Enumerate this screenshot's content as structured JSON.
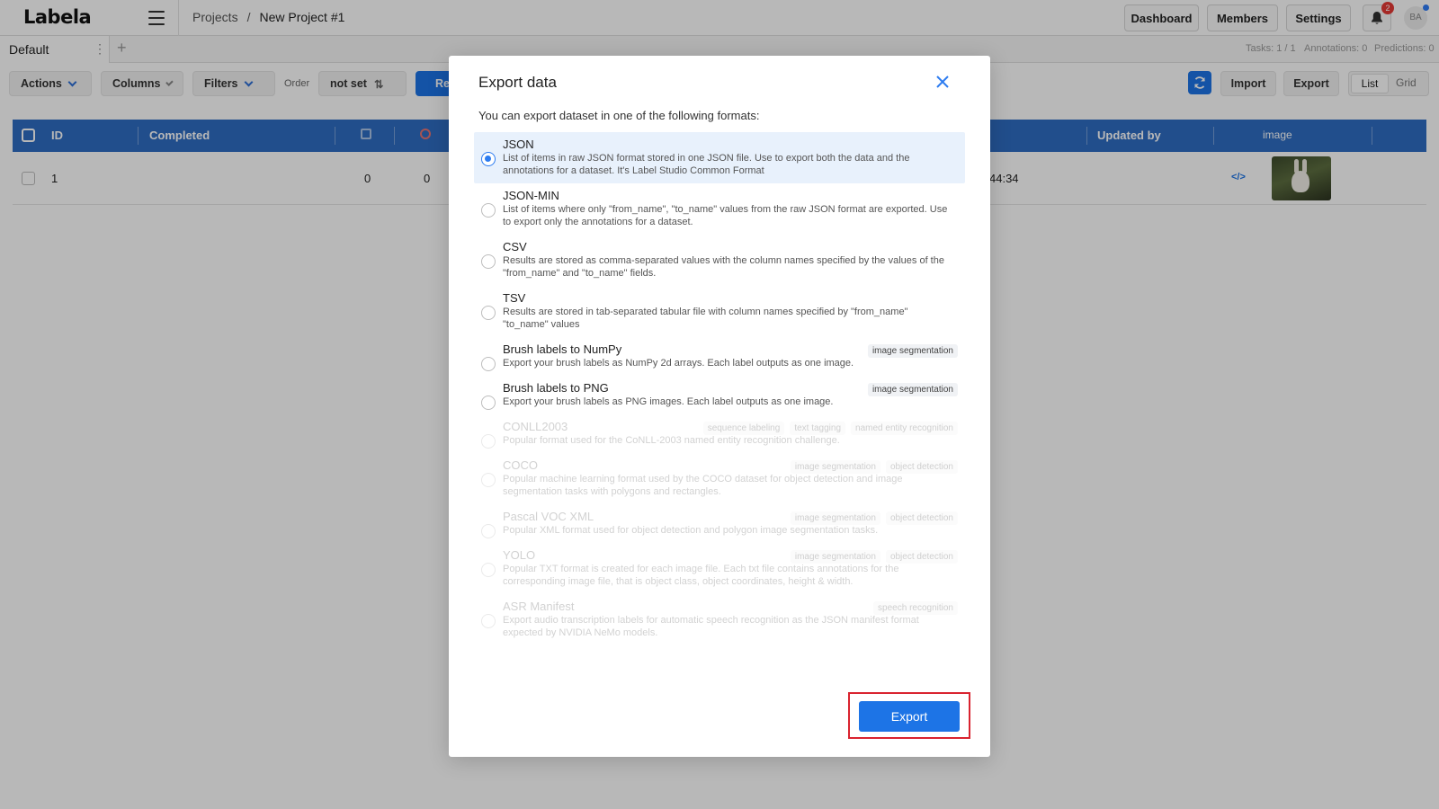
{
  "header": {
    "logo": "Labela",
    "breadcrumbs": [
      "Projects",
      "/",
      "New Project #1"
    ],
    "buttons": {
      "dashboard": "Dashboard",
      "members": "Members",
      "settings": "Settings"
    },
    "notifications_count": "2",
    "avatar_initials": "BA"
  },
  "tabs": {
    "active": "Default",
    "stats": {
      "tasks": "Tasks: 1 / 1",
      "annotations": "Annotations: 0",
      "predictions": "Predictions: 0"
    }
  },
  "toolbar": {
    "actions": "Actions",
    "columns": "Columns",
    "filters": "Filters",
    "order_label": "Order",
    "order_value": "not set",
    "review_partial": "Re",
    "import": "Import",
    "export": "Export",
    "view_list": "List",
    "view_grid": "Grid"
  },
  "table": {
    "headers": {
      "id": "ID",
      "completed": "Completed",
      "updated_by": "Updated by",
      "image": "image"
    },
    "rows": [
      {
        "id": "1",
        "annotations": "0",
        "cancelled": "0",
        "updated_time": "44:34"
      }
    ]
  },
  "modal": {
    "title": "Export data",
    "intro": "You can export dataset in one of the following formats:",
    "formats": [
      {
        "title": "JSON",
        "desc": "List of items in raw JSON format stored in one JSON file. Use to export both the data and the annotations for a dataset. It's Label Studio Common Format",
        "tags": [],
        "selected": true,
        "disabled": false
      },
      {
        "title": "JSON-MIN",
        "desc": "List of items where only \"from_name\", \"to_name\" values from the raw JSON format are exported. Use to export only the annotations for a dataset.",
        "tags": [],
        "selected": false,
        "disabled": false
      },
      {
        "title": "CSV",
        "desc": "Results are stored as comma-separated values with the column names specified by the values of the \"from_name\" and \"to_name\" fields.",
        "tags": [],
        "selected": false,
        "disabled": false
      },
      {
        "title": "TSV",
        "desc": "Results are stored in tab-separated tabular file with column names specified by \"from_name\" \"to_name\" values",
        "tags": [],
        "selected": false,
        "disabled": false
      },
      {
        "title": "Brush labels to NumPy",
        "desc": "Export your brush labels as NumPy 2d arrays. Each label outputs as one image.",
        "tags": [
          "image segmentation"
        ],
        "selected": false,
        "disabled": false
      },
      {
        "title": "Brush labels to PNG",
        "desc": "Export your brush labels as PNG images. Each label outputs as one image.",
        "tags": [
          "image segmentation"
        ],
        "selected": false,
        "disabled": false
      },
      {
        "title": "CONLL2003",
        "desc": "Popular format used for the CoNLL-2003 named entity recognition challenge.",
        "tags": [
          "sequence labeling",
          "text tagging",
          "named entity recognition"
        ],
        "selected": false,
        "disabled": true
      },
      {
        "title": "COCO",
        "desc": "Popular machine learning format used by the COCO dataset for object detection and image segmentation tasks with polygons and rectangles.",
        "tags": [
          "image segmentation",
          "object detection"
        ],
        "selected": false,
        "disabled": true
      },
      {
        "title": "Pascal VOC XML",
        "desc": "Popular XML format used for object detection and polygon image segmentation tasks.",
        "tags": [
          "image segmentation",
          "object detection"
        ],
        "selected": false,
        "disabled": true
      },
      {
        "title": "YOLO",
        "desc": "Popular TXT format is created for each image file. Each txt file contains annotations for the corresponding image file, that is object class, object coordinates, height & width.",
        "tags": [
          "image segmentation",
          "object detection"
        ],
        "selected": false,
        "disabled": true
      },
      {
        "title": "ASR Manifest",
        "desc": "Export audio transcription labels for automatic speech recognition as the JSON manifest format expected by NVIDIA NeMo models.",
        "tags": [
          "speech recognition"
        ],
        "selected": false,
        "disabled": true
      }
    ],
    "export_button": "Export"
  },
  "colors": {
    "primary": "#1d74e6",
    "table_header": "#2e6cc2",
    "highlight": "#d9232f",
    "overlay": "rgba(0,0,0,0.28)"
  }
}
